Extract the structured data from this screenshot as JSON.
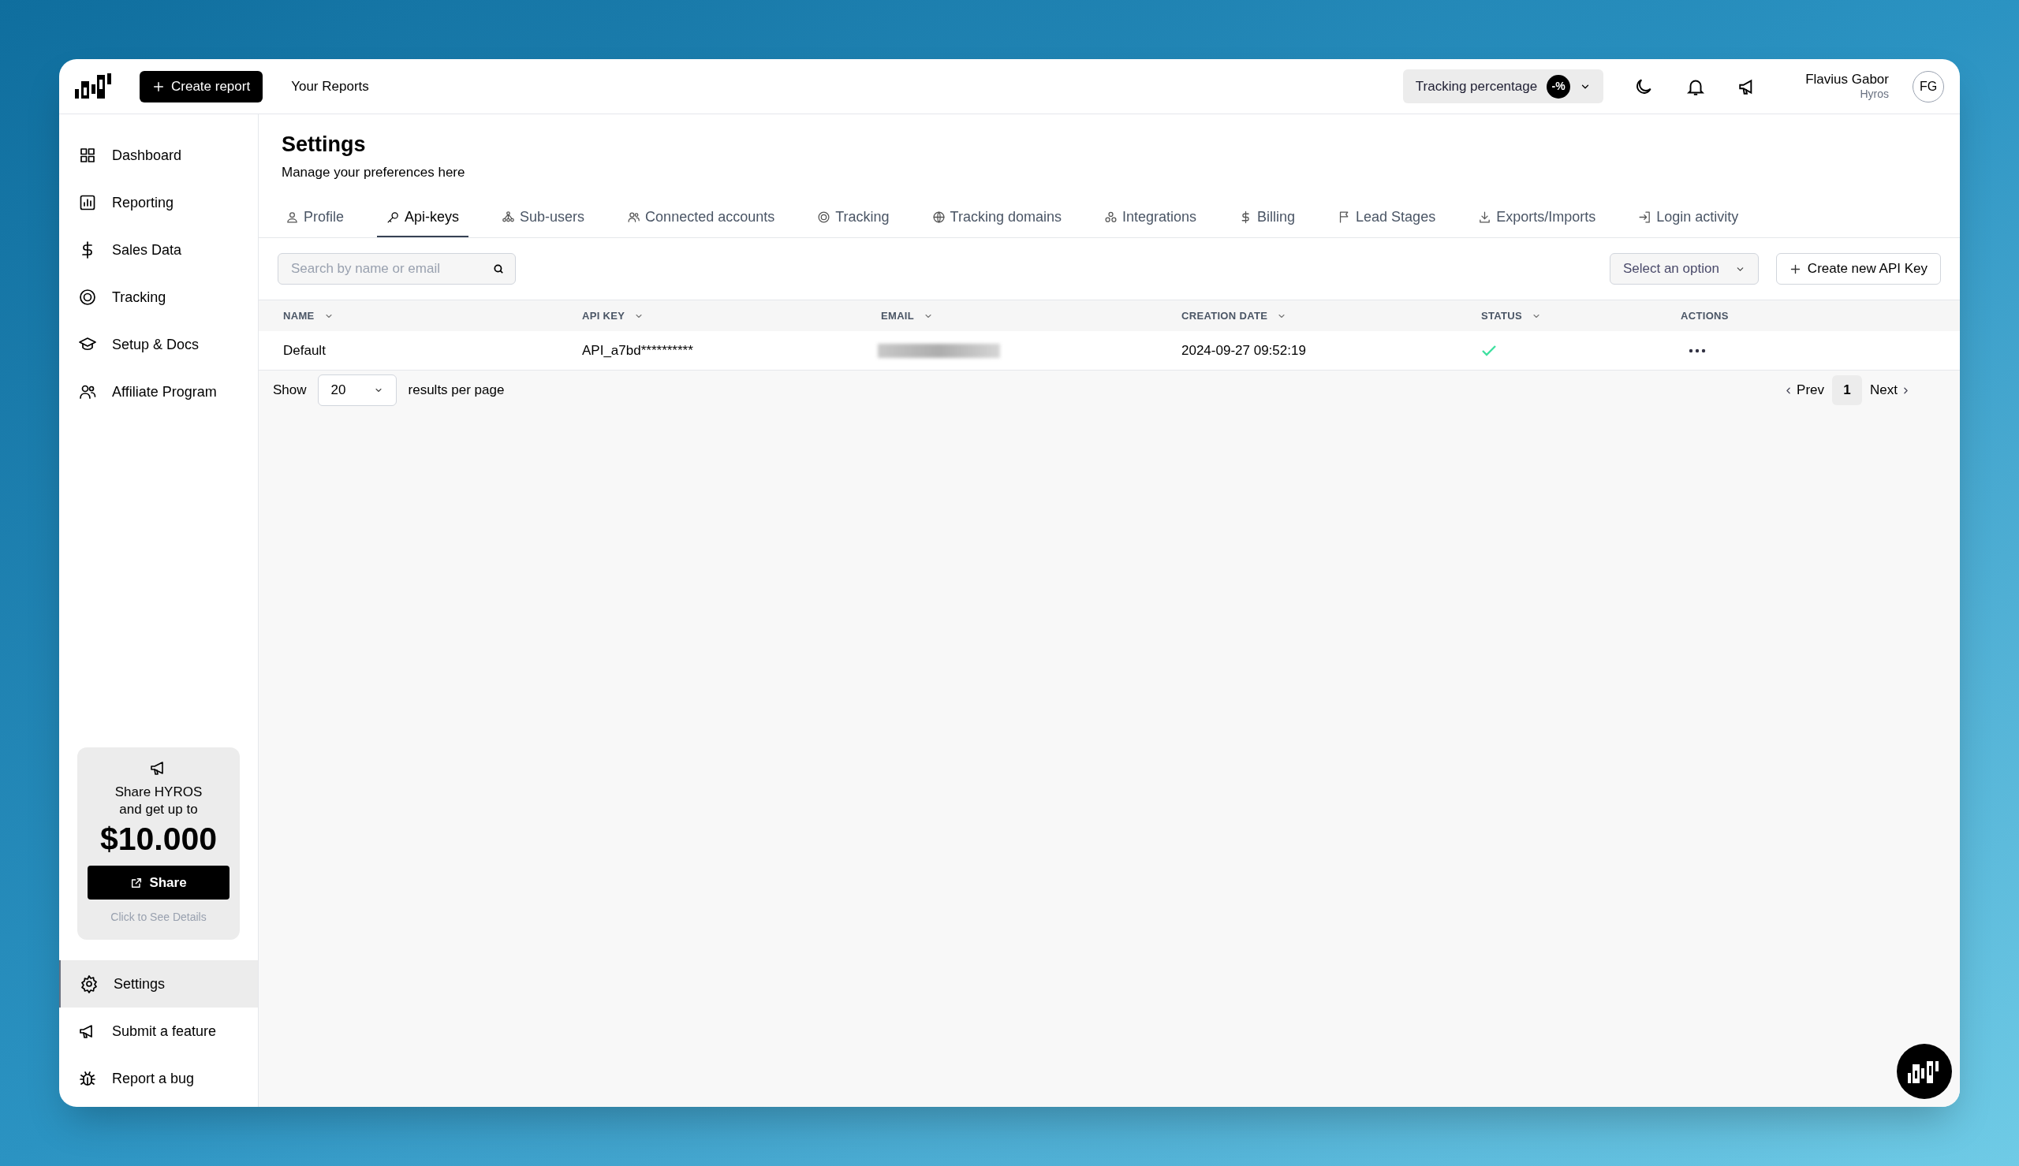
{
  "topbar": {
    "create_button": "Create report",
    "your_reports": "Your Reports",
    "tracking_select": {
      "label": "Tracking percentage",
      "badge": "-%"
    },
    "user": {
      "name": "Flavius Gabor",
      "org": "Hyros",
      "initials": "FG"
    }
  },
  "sidebar": {
    "items": [
      {
        "label": "Dashboard",
        "kind": "grid",
        "selected": false
      },
      {
        "label": "Reporting",
        "kind": "chart",
        "selected": false
      },
      {
        "label": "Sales Data",
        "kind": "dollar",
        "selected": false
      },
      {
        "label": "Tracking",
        "kind": "target",
        "selected": false
      },
      {
        "label": "Setup & Docs",
        "kind": "cap",
        "selected": false
      },
      {
        "label": "Affiliate Program",
        "kind": "users",
        "selected": false
      }
    ],
    "promo": {
      "line_1": "Share HYROS",
      "line_2": "and get up to",
      "amount": "$10.000",
      "button": "Share",
      "details": "Click to See Details"
    },
    "bottom_items": [
      {
        "label": "Settings",
        "kind": "gear",
        "selected": true
      },
      {
        "label": "Submit a feature",
        "kind": "megaphone",
        "selected": false
      },
      {
        "label": "Report a bug",
        "kind": "bug",
        "selected": false
      }
    ]
  },
  "page": {
    "title": "Settings",
    "subtitle": "Manage your preferences here"
  },
  "tabs": [
    {
      "label": "Profile",
      "kind": "user",
      "selected": false
    },
    {
      "label": "Api-keys",
      "kind": "key",
      "selected": true
    },
    {
      "label": "Sub-users",
      "kind": "tree",
      "selected": false
    },
    {
      "label": "Connected accounts",
      "kind": "users",
      "selected": false
    },
    {
      "label": "Tracking",
      "kind": "target",
      "selected": false
    },
    {
      "label": "Tracking domains",
      "kind": "globe",
      "selected": false
    },
    {
      "label": "Integrations",
      "kind": "circles",
      "selected": false
    },
    {
      "label": "Billing",
      "kind": "dollar",
      "selected": false
    },
    {
      "label": "Lead Stages",
      "kind": "flag",
      "selected": false
    },
    {
      "label": "Exports/Imports",
      "kind": "download",
      "selected": false
    },
    {
      "label": "Login activity",
      "kind": "login",
      "selected": false
    }
  ],
  "toolbar": {
    "search": {
      "placeholder": "Search by name or email"
    },
    "filter": {
      "placeholder": "Select an option"
    },
    "create_button": "Create new API Key"
  },
  "table": {
    "columns": [
      {
        "label": "NAME",
        "sortable": true
      },
      {
        "label": "API KEY",
        "sortable": true
      },
      {
        "label": "EMAIL",
        "sortable": true
      },
      {
        "label": "CREATION DATE",
        "sortable": true
      },
      {
        "label": "STATUS",
        "sortable": true
      },
      {
        "label": "ACTIONS",
        "sortable": false
      }
    ],
    "rows": [
      {
        "name": "Default",
        "api_key": "API_a7bd**********",
        "email_redacted": true,
        "creation_date": "2024-09-27 09:52:19",
        "active": true
      }
    ]
  },
  "footer": {
    "show": "Show",
    "per_page": "20",
    "suffix": "results per page",
    "prev": "Prev",
    "pages": [
      {
        "label": "1",
        "selected": true
      }
    ],
    "next": "Next"
  }
}
